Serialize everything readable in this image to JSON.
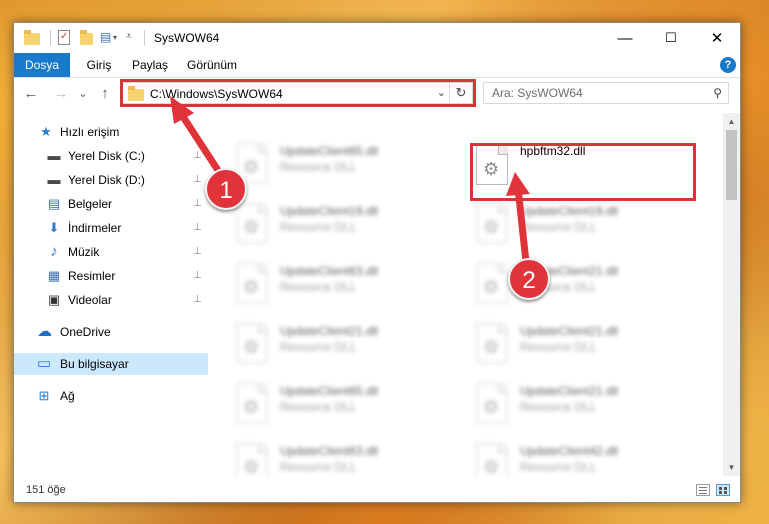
{
  "window": {
    "title": "SysWOW64",
    "controls": {
      "minimize": "—",
      "maximize": "☐",
      "close": "✕"
    }
  },
  "ribbon": {
    "tabs": [
      "Dosya",
      "Giriş",
      "Paylaş",
      "Görünüm"
    ],
    "help": "?"
  },
  "navigation": {
    "back": "←",
    "forward": "→",
    "recent": "⌄",
    "up": "↑"
  },
  "address": {
    "path": "C:\\Windows\\SysWOW64",
    "dropdown": "⌄",
    "refresh": "↻"
  },
  "search": {
    "placeholder": "Ara: SysWOW64",
    "icon": "⚲"
  },
  "sidebar": {
    "items": [
      {
        "label": "Hızlı erişim",
        "icon": "★",
        "color": "#2b7cd3"
      },
      {
        "label": "Yerel Disk (C:)",
        "icon": "▬",
        "color": "#4a4a4a"
      },
      {
        "label": "Yerel Disk (D:)",
        "icon": "▬",
        "color": "#4a4a4a"
      },
      {
        "label": "Belgeler",
        "icon": "▤",
        "color": "#3b6fb0"
      },
      {
        "label": "İndirmeler",
        "icon": "⬇",
        "color": "#2b7cd3"
      },
      {
        "label": "Müzik",
        "icon": "♪",
        "color": "#2b7cd3"
      },
      {
        "label": "Resimler",
        "icon": "▦",
        "color": "#3b6fb0"
      },
      {
        "label": "Videolar",
        "icon": "▣",
        "color": "#333333"
      },
      {
        "label": "OneDrive",
        "icon": "☁",
        "color": "#1e6fc9"
      },
      {
        "label": "Bu bilgisayar",
        "icon": "▭",
        "color": "#2b7cd3"
      },
      {
        "label": "Ağ",
        "icon": "⊞",
        "color": "#2b7cd3"
      }
    ],
    "pin_icon": "📌"
  },
  "files": [
    {
      "name": "UpdateClient65.dll",
      "type": "Resource DLL"
    },
    {
      "name": "hpbftm32.dll",
      "type": ""
    },
    {
      "name": "UpdateClient19.dll",
      "type": "Resource DLL"
    },
    {
      "name": "UpdateClient19.dll",
      "type": "Resource DLL"
    },
    {
      "name": "UpdateClient63.dll",
      "type": "Resource DLL"
    },
    {
      "name": "UpdateClient21.dll",
      "type": "Resource DLL"
    },
    {
      "name": "UpdateClient21.dll",
      "type": "Resource DLL"
    },
    {
      "name": "UpdateClient21.dll",
      "type": "Resource DLL"
    },
    {
      "name": "UpdateClient65.dll",
      "type": "Resource DLL"
    },
    {
      "name": "UpdateClient21.dll",
      "type": "Resource DLL"
    },
    {
      "name": "UpdateClient63.dll",
      "type": "Resource DLL"
    },
    {
      "name": "UpdateClient42.dll",
      "type": "Resource DLL"
    }
  ],
  "status": {
    "count": "151 öğe"
  },
  "markers": {
    "one": "1",
    "two": "2"
  },
  "colors": {
    "highlight": "#d9343a",
    "accent": "#1979ca",
    "selected": "#cce8ff"
  }
}
